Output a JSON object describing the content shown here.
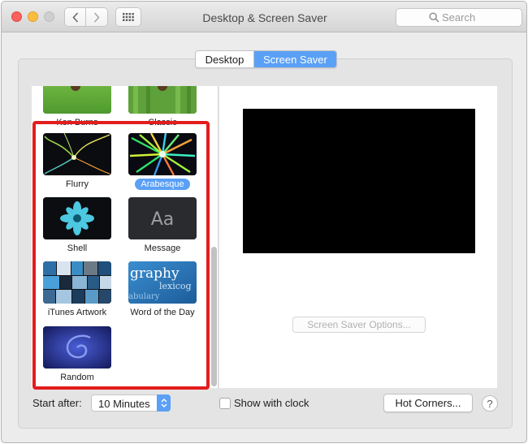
{
  "window": {
    "title": "Desktop & Screen Saver"
  },
  "toolbar": {
    "search_placeholder": "Search"
  },
  "tabs": [
    {
      "label": "Desktop",
      "selected": false
    },
    {
      "label": "Screen Saver",
      "selected": true
    }
  ],
  "screensavers": [
    {
      "label": "Ken Burns",
      "selected": false
    },
    {
      "label": "Classic",
      "selected": false
    },
    {
      "label": "Flurry",
      "selected": false
    },
    {
      "label": "Arabesque",
      "selected": true
    },
    {
      "label": "Shell",
      "selected": false
    },
    {
      "label": "Message",
      "selected": false
    },
    {
      "label": "iTunes Artwork",
      "selected": false
    },
    {
      "label": "Word of the Day",
      "selected": false
    },
    {
      "label": "Random",
      "selected": false
    }
  ],
  "thumb_text": {
    "message": "Aa",
    "word_line1": "graphy",
    "word_line2": "lexicog",
    "word_line3": "abulary"
  },
  "preview": {
    "options_label": "Screen Saver Options..."
  },
  "bottom": {
    "start_after_label": "Start after:",
    "start_after_value": "10 Minutes",
    "show_clock_label": "Show with clock",
    "show_clock_checked": false,
    "hot_corners_label": "Hot Corners...",
    "help_label": "?"
  },
  "colors": {
    "accent": "#5aa0f6",
    "annotation_red": "#e31d1d"
  }
}
